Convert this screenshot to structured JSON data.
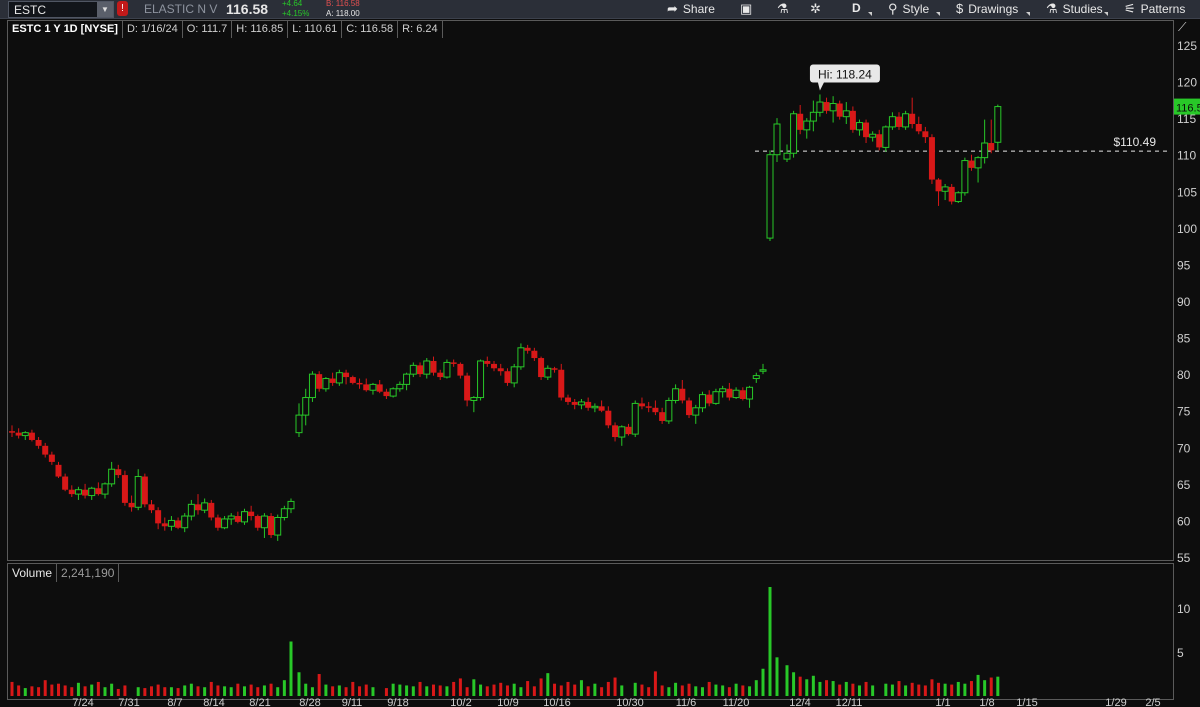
{
  "header": {
    "symbol": "ESTC",
    "alert_icon": "exclamation-icon",
    "company": "ELASTIC N V",
    "last": "116.58",
    "change": "+4.64",
    "change_pct": "+4.15%",
    "bid": "B: 116.58",
    "ask": "A: 118.00",
    "colors": {
      "up": "#28c828",
      "down": "#d81818",
      "accent": "#2b2f38"
    }
  },
  "toolbar": {
    "share": "Share",
    "period": "D",
    "style": "Style",
    "drawings": "Drawings",
    "studies": "Studies",
    "patterns": "Patterns"
  },
  "info": {
    "title": "ESTC 1 Y 1D [NYSE]",
    "date": "D: 1/16/24",
    "open": "O: 111.7",
    "high": "H: 116.85",
    "low": "L: 110.61",
    "close": "C: 116.58",
    "range": "R: 6.24"
  },
  "volume_panel": {
    "label": "Volume",
    "value": "2,241,190"
  },
  "chart_data": [
    {
      "type": "candlestick",
      "title": "ESTC 1 Y 1D [NYSE]",
      "ylim": [
        55,
        127
      ],
      "yticks": [
        55,
        60,
        65,
        70,
        75,
        80,
        85,
        90,
        95,
        100,
        105,
        110,
        115,
        120,
        125
      ],
      "xticks": [
        "7/24",
        "7/31",
        "8/7",
        "8/14",
        "8/21",
        "8/28",
        "9/11",
        "9/18",
        "10/2",
        "10/9",
        "10/16",
        "10/30",
        "11/6",
        "11/20",
        "12/4",
        "12/11",
        "1/1",
        "1/8",
        "1/15",
        "1/29",
        "2/5"
      ],
      "annotations": {
        "high_label": "Hi: 118.24",
        "high_value": 118.24,
        "price_line_label": "$110.49",
        "price_line_value": 110.49,
        "last_tag": "116.58"
      },
      "ohlc": [
        [
          72.2,
          73.0,
          71.4,
          72.0
        ],
        [
          72.0,
          72.6,
          71.2,
          71.6
        ],
        [
          71.6,
          72.2,
          71.0,
          72.0
        ],
        [
          72.0,
          72.4,
          70.8,
          71.0
        ],
        [
          71.0,
          71.4,
          69.8,
          70.2
        ],
        [
          70.2,
          70.6,
          68.6,
          69.0
        ],
        [
          69.0,
          69.4,
          67.6,
          68.0
        ],
        [
          67.6,
          68.0,
          65.8,
          66.0
        ],
        [
          66.0,
          66.4,
          64.0,
          64.2
        ],
        [
          64.2,
          64.8,
          63.2,
          63.6
        ],
        [
          63.6,
          64.6,
          62.8,
          64.2
        ],
        [
          64.2,
          65.0,
          63.0,
          63.4
        ],
        [
          63.4,
          64.6,
          62.8,
          64.4
        ],
        [
          64.4,
          65.2,
          63.4,
          63.6
        ],
        [
          63.6,
          65.2,
          63.0,
          65.0
        ],
        [
          65.0,
          68.0,
          64.6,
          67.0
        ],
        [
          67.0,
          67.6,
          65.8,
          66.2
        ],
        [
          66.2,
          66.8,
          62.0,
          62.4
        ],
        [
          62.4,
          63.4,
          61.2,
          61.8
        ],
        [
          61.8,
          67.0,
          61.4,
          66.0
        ],
        [
          66.0,
          66.4,
          61.8,
          62.2
        ],
        [
          62.2,
          62.8,
          61.0,
          61.4
        ],
        [
          61.4,
          61.8,
          58.8,
          59.6
        ],
        [
          59.6,
          60.4,
          58.6,
          59.2
        ],
        [
          59.2,
          60.6,
          58.6,
          60.0
        ],
        [
          60.0,
          60.4,
          58.8,
          59.0
        ],
        [
          59.0,
          61.0,
          58.4,
          60.6
        ],
        [
          60.6,
          62.8,
          60.0,
          62.2
        ],
        [
          62.2,
          63.6,
          60.8,
          61.4
        ],
        [
          61.4,
          63.0,
          61.0,
          62.4
        ],
        [
          62.4,
          62.8,
          60.0,
          60.4
        ],
        [
          60.4,
          60.8,
          58.6,
          59.0
        ],
        [
          59.0,
          60.6,
          58.8,
          60.2
        ],
        [
          60.2,
          61.0,
          59.4,
          60.6
        ],
        [
          60.6,
          61.2,
          59.6,
          59.8
        ],
        [
          59.8,
          61.6,
          59.4,
          61.2
        ],
        [
          61.2,
          62.0,
          60.0,
          60.6
        ],
        [
          60.6,
          60.8,
          58.6,
          59.0
        ],
        [
          59.0,
          61.0,
          57.6,
          60.6
        ],
        [
          60.6,
          61.0,
          57.6,
          58.0
        ],
        [
          58.0,
          60.8,
          57.2,
          60.4
        ],
        [
          60.4,
          62.0,
          60.0,
          61.6
        ],
        [
          61.6,
          63.0,
          61.0,
          62.6
        ],
        [
          72.0,
          76.0,
          71.4,
          74.4
        ],
        [
          74.4,
          78.0,
          73.0,
          76.8
        ],
        [
          76.8,
          80.4,
          76.2,
          80.0
        ],
        [
          80.0,
          80.4,
          77.6,
          78.0
        ],
        [
          78.0,
          79.6,
          77.6,
          79.4
        ],
        [
          79.4,
          80.2,
          78.4,
          78.8
        ],
        [
          78.8,
          80.6,
          78.4,
          80.2
        ],
        [
          80.2,
          80.6,
          78.6,
          79.6
        ],
        [
          79.6,
          79.8,
          78.6,
          78.8
        ],
        [
          78.8,
          79.4,
          78.0,
          78.6
        ],
        [
          78.6,
          79.4,
          77.6,
          77.8
        ],
        [
          77.8,
          78.8,
          77.2,
          78.6
        ],
        [
          78.6,
          79.2,
          77.4,
          77.6
        ],
        [
          77.6,
          78.0,
          76.6,
          77.0
        ],
        [
          77.0,
          78.2,
          76.8,
          78.0
        ],
        [
          78.0,
          79.0,
          77.6,
          78.6
        ],
        [
          78.6,
          80.2,
          77.8,
          80.0
        ],
        [
          80.0,
          81.6,
          79.6,
          81.2
        ],
        [
          81.2,
          81.6,
          79.6,
          80.0
        ],
        [
          80.0,
          82.2,
          79.4,
          81.8
        ],
        [
          81.8,
          82.4,
          79.8,
          80.2
        ],
        [
          80.2,
          80.6,
          79.2,
          79.6
        ],
        [
          79.6,
          82.0,
          79.4,
          81.6
        ],
        [
          81.6,
          82.0,
          81.0,
          81.4
        ],
        [
          81.4,
          81.6,
          79.4,
          79.8
        ],
        [
          79.8,
          80.2,
          75.6,
          76.4
        ],
        [
          76.4,
          77.0,
          74.8,
          76.8
        ],
        [
          76.8,
          82.0,
          76.4,
          81.8
        ],
        [
          81.8,
          82.4,
          81.0,
          81.4
        ],
        [
          81.4,
          81.8,
          80.4,
          80.8
        ],
        [
          80.8,
          81.4,
          79.8,
          80.4
        ],
        [
          80.4,
          80.8,
          78.4,
          78.8
        ],
        [
          78.8,
          81.4,
          78.2,
          81.0
        ],
        [
          81.0,
          84.2,
          80.6,
          83.6
        ],
        [
          83.6,
          84.0,
          82.8,
          83.2
        ],
        [
          83.2,
          83.6,
          81.8,
          82.2
        ],
        [
          82.2,
          82.4,
          79.2,
          79.6
        ],
        [
          79.6,
          81.2,
          79.2,
          80.8
        ],
        [
          80.8,
          81.0,
          80.2,
          80.6
        ],
        [
          80.6,
          81.4,
          76.4,
          76.8
        ],
        [
          76.8,
          77.2,
          75.8,
          76.2
        ],
        [
          76.2,
          76.6,
          75.2,
          75.8
        ],
        [
          75.8,
          76.6,
          75.2,
          76.2
        ],
        [
          76.2,
          76.8,
          75.0,
          75.4
        ],
        [
          75.4,
          76.0,
          74.8,
          75.6
        ],
        [
          75.6,
          76.4,
          74.8,
          75.0
        ],
        [
          75.0,
          75.6,
          72.6,
          73.0
        ],
        [
          73.0,
          73.4,
          70.8,
          71.4
        ],
        [
          71.4,
          73.0,
          70.2,
          72.8
        ],
        [
          72.8,
          73.2,
          71.6,
          71.8
        ],
        [
          71.8,
          76.4,
          71.4,
          76.0
        ],
        [
          76.0,
          76.8,
          75.2,
          75.6
        ],
        [
          75.6,
          76.2,
          74.8,
          75.4
        ],
        [
          75.4,
          76.4,
          74.4,
          74.8
        ],
        [
          74.8,
          75.4,
          73.2,
          73.6
        ],
        [
          73.6,
          76.8,
          73.2,
          76.4
        ],
        [
          76.4,
          78.6,
          76.0,
          78.0
        ],
        [
          78.0,
          79.2,
          76.0,
          76.4
        ],
        [
          76.4,
          76.8,
          74.0,
          74.4
        ],
        [
          74.4,
          75.8,
          73.2,
          75.4
        ],
        [
          75.4,
          77.6,
          74.8,
          77.2
        ],
        [
          77.2,
          77.8,
          75.6,
          76.0
        ],
        [
          76.0,
          78.0,
          75.8,
          77.6
        ],
        [
          77.6,
          78.4,
          76.8,
          78.0
        ],
        [
          78.0,
          78.8,
          76.4,
          76.8
        ],
        [
          76.8,
          78.2,
          76.6,
          77.8
        ],
        [
          77.8,
          78.2,
          76.4,
          76.6
        ],
        [
          76.6,
          78.4,
          75.4,
          78.2
        ],
        [
          79.4,
          80.2,
          78.8,
          79.8
        ],
        [
          80.4,
          81.4,
          80.0,
          80.6
        ],
        [
          98.6,
          110.6,
          98.2,
          110.0
        ],
        [
          110.0,
          115.0,
          109.0,
          114.2
        ],
        [
          109.4,
          111.4,
          109.0,
          110.2
        ],
        [
          110.2,
          116.0,
          109.6,
          115.6
        ],
        [
          115.6,
          116.8,
          112.8,
          113.4
        ],
        [
          113.4,
          115.0,
          112.2,
          114.6
        ],
        [
          114.6,
          117.4,
          113.2,
          115.8
        ],
        [
          115.8,
          118.24,
          115.2,
          117.2
        ],
        [
          117.2,
          117.8,
          115.6,
          116.0
        ],
        [
          116.0,
          118.0,
          114.4,
          117.0
        ],
        [
          117.0,
          117.4,
          114.8,
          115.2
        ],
        [
          115.2,
          117.2,
          114.2,
          116.0
        ],
        [
          116.0,
          116.6,
          113.0,
          113.4
        ],
        [
          113.4,
          114.8,
          112.6,
          114.4
        ],
        [
          114.4,
          114.8,
          111.6,
          112.4
        ],
        [
          112.4,
          113.2,
          111.8,
          112.8
        ],
        [
          112.8,
          113.4,
          110.6,
          111.0
        ],
        [
          111.0,
          114.0,
          110.4,
          113.8
        ],
        [
          113.8,
          115.8,
          113.4,
          115.2
        ],
        [
          115.2,
          115.8,
          113.4,
          113.8
        ],
        [
          113.8,
          116.0,
          113.4,
          115.6
        ],
        [
          115.6,
          117.8,
          113.6,
          114.2
        ],
        [
          114.2,
          115.2,
          112.8,
          113.2
        ],
        [
          113.2,
          113.8,
          111.6,
          112.4
        ],
        [
          112.4,
          112.8,
          106.0,
          106.6
        ],
        [
          106.6,
          106.8,
          103.0,
          105.0
        ],
        [
          105.0,
          106.0,
          103.8,
          105.6
        ],
        [
          105.6,
          106.0,
          103.2,
          103.6
        ],
        [
          103.6,
          105.0,
          103.4,
          104.8
        ],
        [
          104.8,
          109.6,
          104.4,
          109.2
        ],
        [
          109.2,
          110.0,
          107.8,
          108.2
        ],
        [
          108.2,
          109.8,
          106.2,
          109.6
        ],
        [
          109.6,
          114.8,
          108.8,
          111.6
        ],
        [
          111.6,
          114.8,
          110.2,
          110.6
        ],
        [
          111.7,
          116.85,
          110.61,
          116.58
        ]
      ]
    },
    {
      "type": "bar",
      "title": "Volume",
      "ylim": [
        0,
        13
      ],
      "yticks": [
        5,
        10
      ],
      "unit": "millions",
      "values": [
        1.6,
        1.2,
        0.9,
        1.1,
        1.0,
        1.8,
        1.3,
        1.4,
        1.2,
        1.0,
        1.5,
        1.1,
        1.3,
        1.6,
        1.0,
        1.4,
        0.8,
        1.2,
        1.0,
        0.9,
        1.1,
        1.3,
        1.0,
        1.0,
        0.9,
        1.2,
        1.4,
        1.1,
        1.0,
        1.6,
        1.2,
        1.1,
        1.0,
        1.4,
        1.1,
        1.3,
        1.0,
        1.2,
        1.4,
        1.0,
        1.8,
        6.2,
        2.7,
        1.4,
        1.0,
        2.5,
        1.3,
        1.1,
        1.2,
        1.0,
        1.6,
        1.1,
        1.3,
        1.0,
        0.9,
        1.4,
        1.3,
        1.2,
        1.1,
        1.6,
        1.1,
        1.3,
        1.2,
        1.1,
        1.6,
        2.0,
        1.0,
        1.9,
        1.3,
        1.1,
        1.3,
        1.5,
        1.2,
        1.4,
        1.0,
        1.7,
        1.1,
        2.0,
        2.6,
        1.4,
        1.2,
        1.6,
        1.3,
        1.8,
        1.1,
        1.4,
        1.0,
        1.6,
        2.1,
        1.2,
        1.5,
        1.3,
        1.0,
        2.8,
        1.2,
        1.0,
        1.5,
        1.2,
        1.4,
        1.1,
        1.0,
        1.6,
        1.3,
        1.2,
        1.0,
        1.4,
        1.2,
        1.1,
        1.8,
        3.1,
        12.4,
        4.4,
        3.5,
        2.7,
        2.2,
        1.9,
        2.3,
        1.6,
        1.8,
        1.7,
        1.3,
        1.6,
        1.4,
        1.2,
        1.6,
        1.2,
        1.4,
        1.3,
        1.7,
        1.2,
        1.5,
        1.3,
        1.2,
        1.9,
        1.5,
        1.4,
        1.3,
        1.6,
        1.4,
        1.7,
        2.4,
        1.8,
        2.1,
        2.2
      ],
      "colors_up_down": "by candle direction"
    }
  ]
}
